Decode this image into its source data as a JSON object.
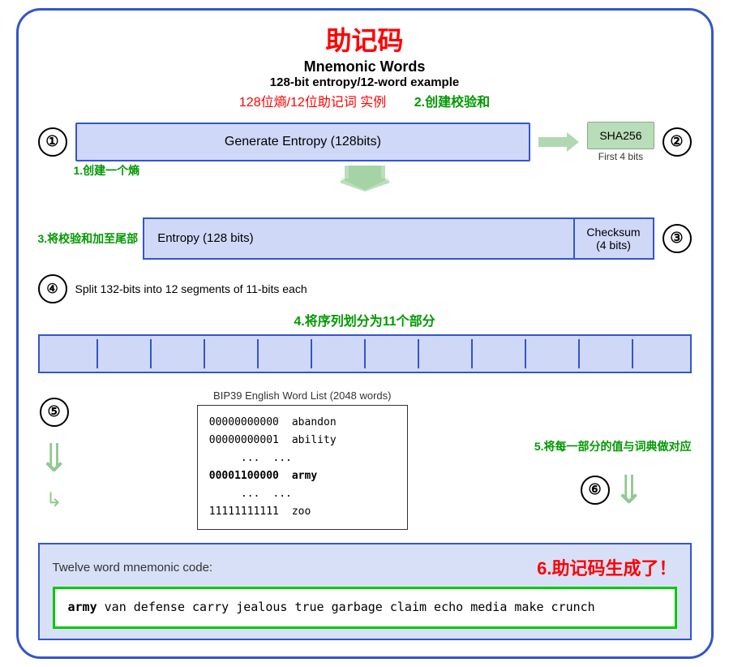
{
  "title": {
    "zh": "助记码",
    "en_line1": "Mnemonic Words",
    "en_line2": "128-bit entropy/12-word example",
    "zh_example": "128位熵/12位助记词 实例"
  },
  "step2_label": "2.创建校验和",
  "step1_label": "1.创建一个熵",
  "step3_label": "3.将校验和加至尾部",
  "step4_label_en": "Split 132-bits into 12 segments of 11-bits each",
  "step4_label_zh": "4.将序列划分为11个部分",
  "step5_label": "5.将每一部分的值与词典做对应",
  "step6_label": "6.助记码生成了！",
  "entropy_box": "Generate Entropy (128bits)",
  "sha_box": "SHA256",
  "sha_first4": "First 4 bits",
  "entropy_long": "Entropy (128 bits)",
  "checksum": "Checksum\n(4 bits)",
  "bip39_title": "BIP39 English Word List (2048 words)",
  "bip39_rows": [
    {
      "bits": "00000000000",
      "word": "abandon",
      "highlighted": false
    },
    {
      "bits": "00000000001",
      "word": "ability",
      "highlighted": false
    },
    {
      "bits": "...",
      "word": "...",
      "highlighted": false
    },
    {
      "bits": "00001100000",
      "word": "army",
      "highlighted": true
    },
    {
      "bits": "...",
      "word": "...",
      "highlighted": false
    },
    {
      "bits": "11111111111",
      "word": "zoo",
      "highlighted": false
    }
  ],
  "twelve_word_label": "Twelve word mnemonic code:",
  "mnemonic_bold": "army",
  "mnemonic_rest": " van defense carry jealous true garbage claim echo media make crunch",
  "circles": {
    "c1": "①",
    "c2": "②",
    "c3": "③",
    "c4": "④",
    "c5": "⑤",
    "c6": "⑥"
  }
}
